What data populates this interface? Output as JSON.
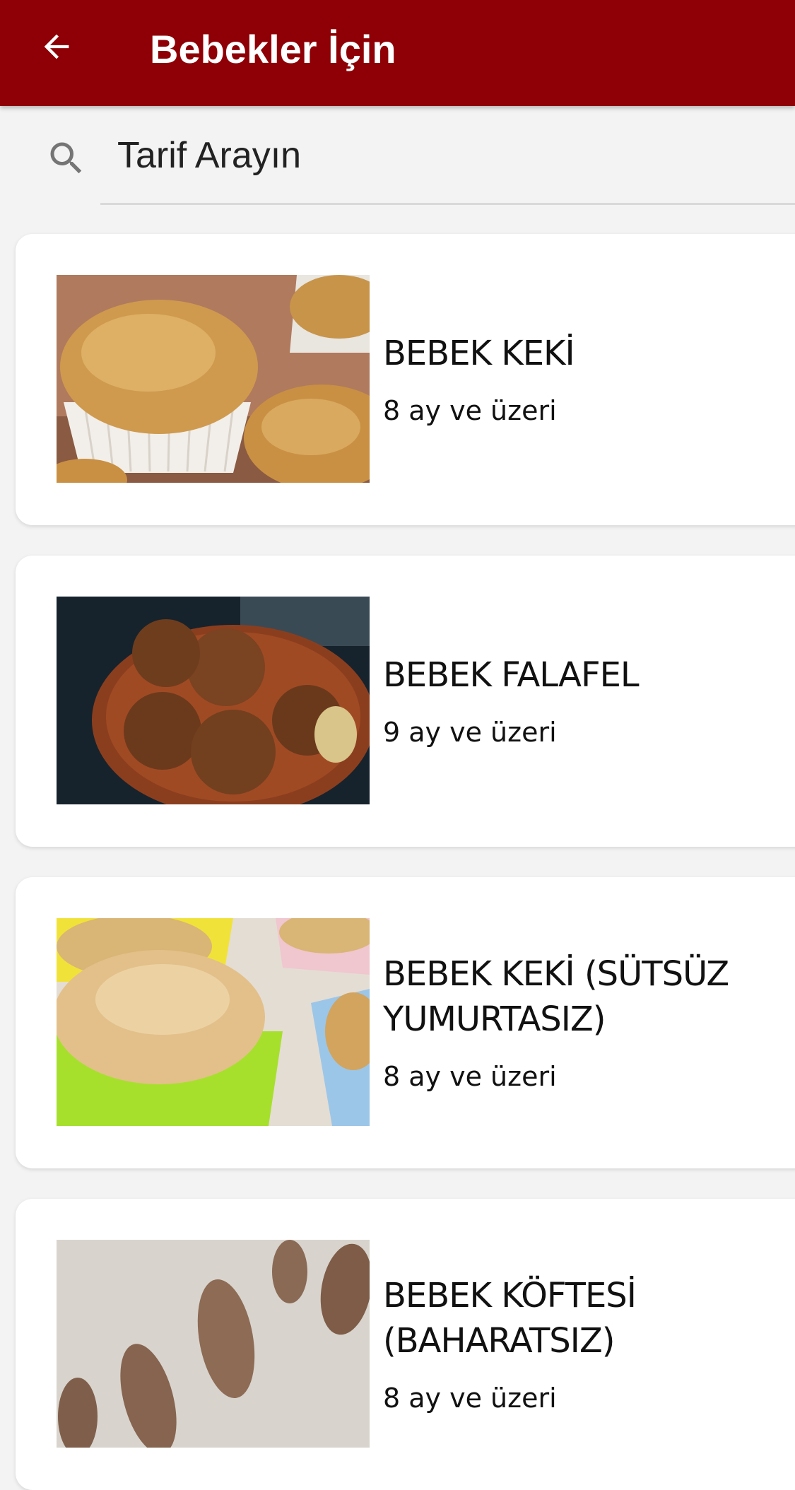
{
  "header": {
    "title": "Bebekler İçin",
    "back_icon": "arrow-back-icon",
    "background_color": "#8e0005"
  },
  "search": {
    "placeholder": "Tarif Arayın",
    "icon": "search-icon"
  },
  "recipes": [
    {
      "title": "BEBEK KEKİ",
      "age": "8 ay ve üzeri",
      "image": "muffins-in-paper-cups"
    },
    {
      "title": "BEBEK FALAFEL",
      "age": "9 ay ve üzeri",
      "image": "falafel-balls-in-bowl"
    },
    {
      "title": "BEBEK KEKİ (SÜTSÜZ YUMURTASIZ)",
      "age": "8 ay ve üzeri",
      "image": "muffins-in-silicone-cups"
    },
    {
      "title": "BEBEK KÖFTESİ (BAHARATSIZ)",
      "age": "8 ay ve üzeri",
      "image": "meatballs-on-board"
    }
  ]
}
